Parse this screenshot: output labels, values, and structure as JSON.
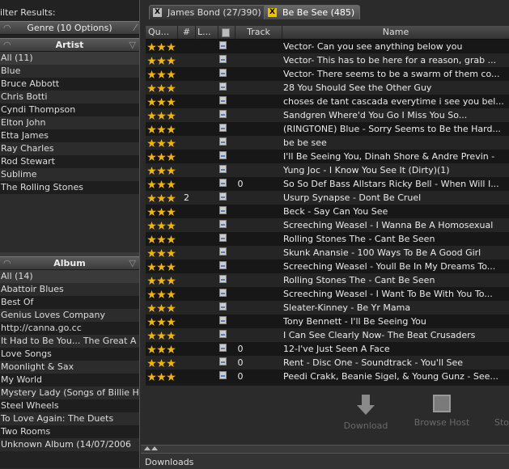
{
  "filter": {
    "title": "ilter Results:",
    "genre_bar": "Genre (10 Options)",
    "artist_header": "Artist",
    "artists": [
      "All (11)",
      "Blue",
      "Bruce Abbott",
      "Chris Botti",
      "Cyndi Thompson",
      "Elton John",
      "Etta James",
      "Ray Charles",
      "Rod Stewart",
      "Sublime",
      "The Rolling Stones"
    ],
    "album_header": "Album",
    "albums": [
      "All (14)",
      "Abattoir Blues",
      "Best Of",
      "Genius Loves Company",
      "http://canna.go.cc",
      "It Had to Be You... The Great A",
      "Love Songs",
      "Moonlight & Sax",
      "My World",
      "Mystery Lady (Songs of Billie Ho",
      "Steel Wheels",
      "To Love Again: The Duets",
      "Two Rooms",
      "Unknown Album (14/07/2006"
    ]
  },
  "tabs": [
    {
      "label": "James Bond  (27/390)",
      "active": false
    },
    {
      "label": "Be Be See  (485)",
      "active": true
    }
  ],
  "columns": [
    "Qu...",
    "#",
    "L...",
    "",
    "Track",
    "Name"
  ],
  "rows": [
    {
      "num": "",
      "track": "",
      "name": "Vector- Can you see anything below you"
    },
    {
      "num": "",
      "track": "",
      "name": "Vector- This has to be here for a reason, grab ..."
    },
    {
      "num": "",
      "track": "",
      "name": "Vector- There seems to be a swarm of them co..."
    },
    {
      "num": "",
      "track": "",
      "name": "28 You Should See the Other Guy"
    },
    {
      "num": "",
      "track": "",
      "name": "choses de tant cascada everytime i see you bel..."
    },
    {
      "num": "",
      "track": "",
      "name": "Sandgren          Where'd You Go I Miss You So..."
    },
    {
      "num": "",
      "track": "",
      "name": "(RINGTONE) Blue - Sorry Seems to Be the Hard..."
    },
    {
      "num": "",
      "track": "",
      "name": "be be see"
    },
    {
      "num": "",
      "track": "",
      "name": "I'll Be Seeing You, Dinah Shore & Andre Previn -"
    },
    {
      "num": "",
      "track": "",
      "name": "Yung Joc - I Know You See It (Dirty)(1)"
    },
    {
      "num": "",
      "track": "0",
      "name": "So So Def Bass Allstars Ricky Bell - When Will I..."
    },
    {
      "num": "2",
      "track": "",
      "name": "Usurp Synapse - Dont Be Cruel"
    },
    {
      "num": "",
      "track": "",
      "name": "Beck - Say Can You See"
    },
    {
      "num": "",
      "track": "",
      "name": "Screeching Weasel - I Wanna Be A Homosexual"
    },
    {
      "num": "",
      "track": "",
      "name": "Rolling Stones The - Cant Be Seen"
    },
    {
      "num": "",
      "track": "",
      "name": "Skunk Anansie - 100 Ways To Be A Good Girl"
    },
    {
      "num": "",
      "track": "",
      "name": "Screeching Weasel - Youll Be In My Dreams To..."
    },
    {
      "num": "",
      "track": "",
      "name": "Rolling Stones The - Cant Be Seen"
    },
    {
      "num": "",
      "track": "",
      "name": "Screeching Weasel - I Want To Be With You To..."
    },
    {
      "num": "",
      "track": "",
      "name": "Sleater-Kinney - Be Yr Mama"
    },
    {
      "num": "",
      "track": "",
      "name": "Tony Bennett - I'll Be Seeing You"
    },
    {
      "num": "",
      "track": "",
      "name": "I Can See Clearly Now- The Beat Crusaders"
    },
    {
      "num": "",
      "track": "0",
      "name": "12-I've Just Seen A Face"
    },
    {
      "num": "",
      "track": "0",
      "name": "Rent - Disc One - Soundtrack - You'll See"
    },
    {
      "num": "",
      "track": "0",
      "name": "Peedi Crakk, Beanie Sigel, & Young Gunz - See..."
    }
  ],
  "toolbar": {
    "download_label": "Download",
    "browse_host_label": "Browse Host",
    "third_label": "Sto"
  },
  "downloads_label": "Downloads",
  "colors": {
    "star": "#f3b312",
    "active_tab_close": "#f0c000"
  }
}
